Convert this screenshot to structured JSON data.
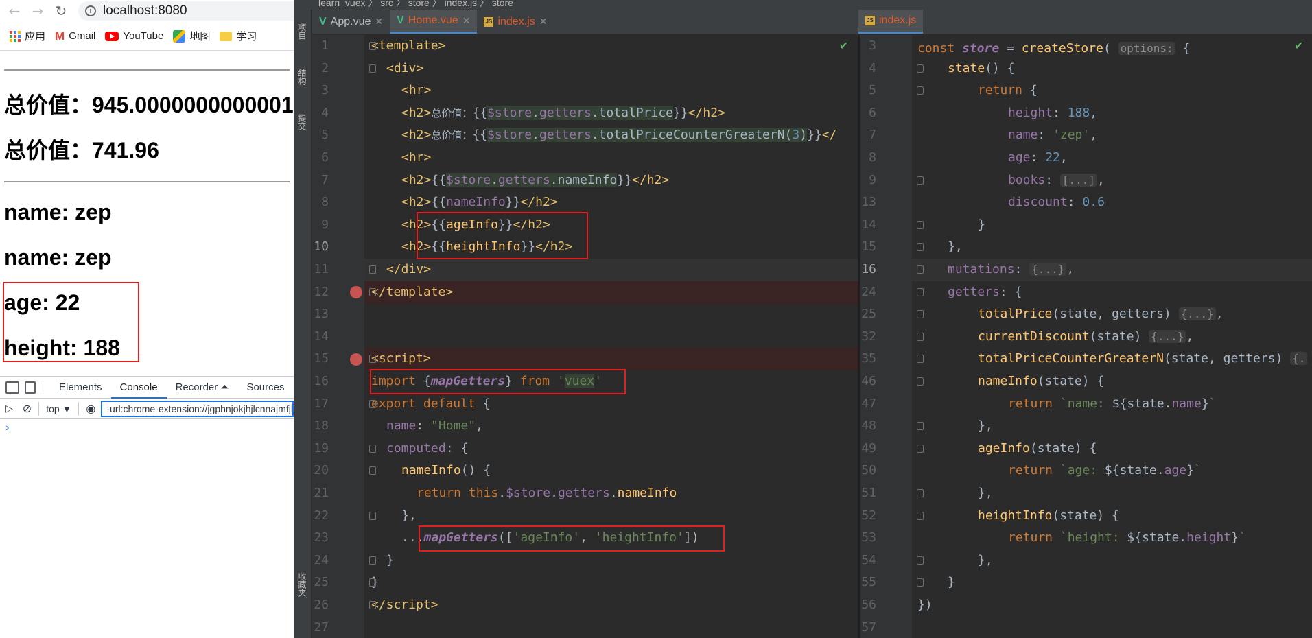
{
  "browser": {
    "url": "localhost:8080",
    "bookmarks": [
      {
        "label": "应用",
        "icon": "apps-grid-icon"
      },
      {
        "label": "Gmail",
        "icon": "gmail-icon"
      },
      {
        "label": "YouTube",
        "icon": "youtube-icon"
      },
      {
        "label": "地图",
        "icon": "maps-icon"
      },
      {
        "label": "学习",
        "icon": "folder-icon"
      }
    ],
    "content": {
      "total_price_1": "总价值：945.0000000000001",
      "total_price_2": "总价值：741.96",
      "name_1": "name: zep",
      "name_2": "name: zep",
      "age": "age: 22",
      "height": "height: 188"
    },
    "devtools": {
      "tabs": [
        "Elements",
        "Console",
        "Recorder ⏶",
        "Sources"
      ],
      "active_tab": "Console",
      "context": "top ▼",
      "filter": "-url:chrome-extension://jgphnjokjhjlcnnajmfjlacjbmjmbmhg",
      "prompt": "›"
    }
  },
  "ide": {
    "top_bar": "learn_vuex  〉 src 〉 store 〉 index.js 〉 store",
    "side_labels": [
      "项目",
      "结构",
      "提交",
      "收藏夹"
    ],
    "left_tabs": [
      {
        "label": "App.vue",
        "type": "vue",
        "active": false
      },
      {
        "label": "Home.vue",
        "type": "vue",
        "active": true
      },
      {
        "label": "index.js",
        "type": "js",
        "active": false
      }
    ],
    "right_tabs": [
      {
        "label": "index.js",
        "type": "js",
        "active": true
      }
    ],
    "left_line_numbers": [
      "1",
      "2",
      "3",
      "4",
      "5",
      "6",
      "7",
      "8",
      "9",
      "10",
      "11",
      "12",
      "13",
      "14",
      "15",
      "16",
      "17",
      "18",
      "19",
      "20",
      "21",
      "22",
      "23",
      "24",
      "25",
      "26",
      "27"
    ],
    "right_line_numbers": [
      "3",
      "4",
      "5",
      "6",
      "7",
      "8",
      "9",
      "13",
      "14",
      "15",
      "16",
      "24",
      "25",
      "32",
      "35",
      "46",
      "47",
      "48",
      "49",
      "50",
      "51",
      "52",
      "53",
      "54",
      "55",
      "56",
      "57"
    ],
    "current_line_left": "10",
    "current_line_right": "16",
    "colors": {
      "accent": "#4a88c7",
      "breakpoint": "#c75450",
      "annotation_box": "#e02020"
    }
  }
}
